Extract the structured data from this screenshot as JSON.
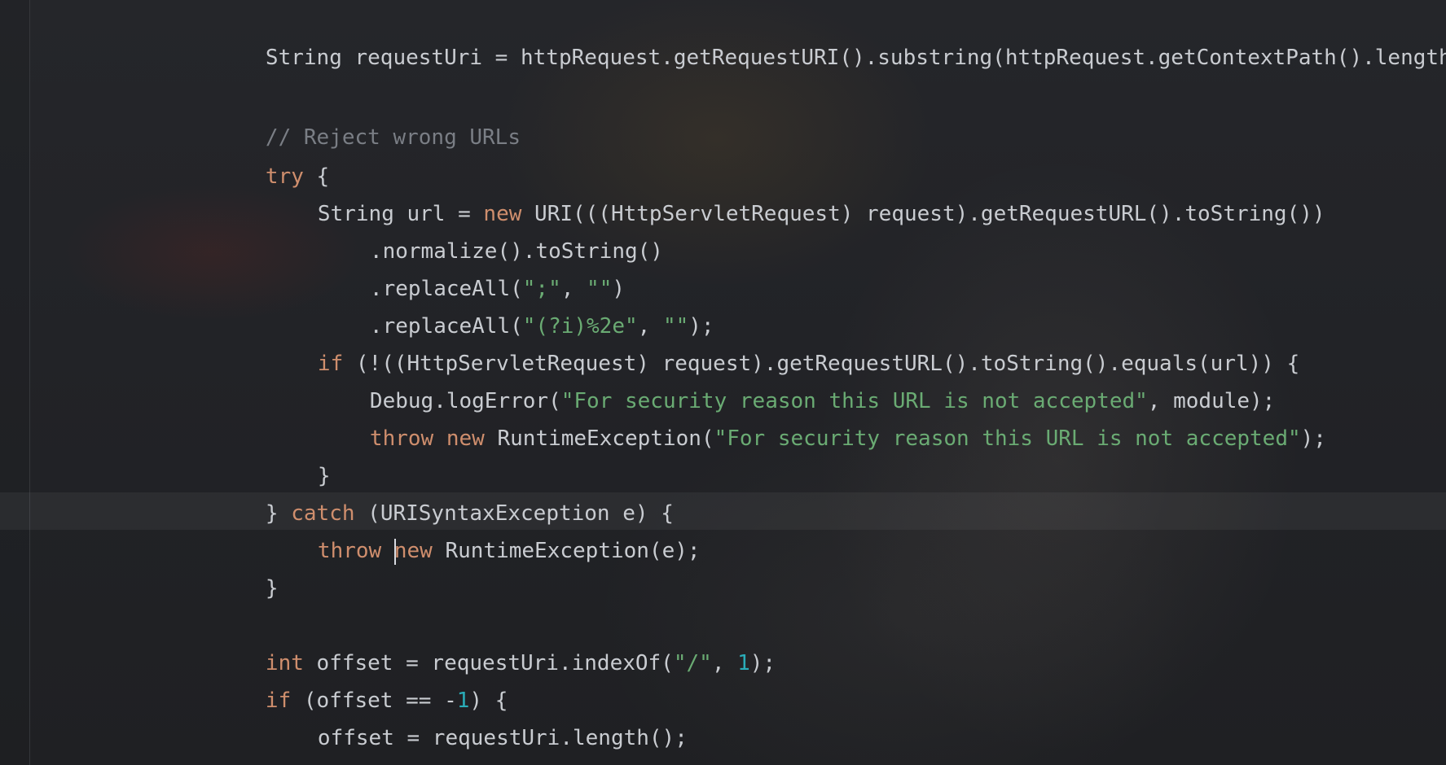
{
  "code_lines": [
    [
      {
        "t": "String requestUri = httpRequest.getRequestURI().substring(httpRequest.getContextPath().length());",
        "c": "plain"
      }
    ],
    [],
    [
      {
        "t": "// Reject wrong URLs",
        "c": "cmt"
      }
    ],
    [
      {
        "t": "try",
        "c": "kw"
      },
      {
        "t": " {",
        "c": "plain"
      }
    ],
    [
      {
        "t": "String url = ",
        "c": "plain"
      },
      {
        "t": "new",
        "c": "kw"
      },
      {
        "t": " URI(((HttpServletRequest) request).getRequestURL().toString())",
        "c": "plain"
      }
    ],
    [
      {
        "t": ".normalize().toString()",
        "c": "plain"
      }
    ],
    [
      {
        "t": ".replaceAll(",
        "c": "plain"
      },
      {
        "t": "\";\"",
        "c": "str"
      },
      {
        "t": ", ",
        "c": "plain"
      },
      {
        "t": "\"\"",
        "c": "str"
      },
      {
        "t": ")",
        "c": "plain"
      }
    ],
    [
      {
        "t": ".replaceAll(",
        "c": "plain"
      },
      {
        "t": "\"(?i)%2e\"",
        "c": "str"
      },
      {
        "t": ", ",
        "c": "plain"
      },
      {
        "t": "\"\"",
        "c": "str"
      },
      {
        "t": ");",
        "c": "plain"
      }
    ],
    [
      {
        "t": "if",
        "c": "kw"
      },
      {
        "t": " (!((HttpServletRequest) request).getRequestURL().toString().equals(url)) {",
        "c": "plain"
      }
    ],
    [
      {
        "t": "Debug.logError(",
        "c": "plain"
      },
      {
        "t": "\"For security reason this URL is not accepted\"",
        "c": "str"
      },
      {
        "t": ", module);",
        "c": "plain"
      }
    ],
    [
      {
        "t": "throw",
        "c": "kw"
      },
      {
        "t": " ",
        "c": "plain"
      },
      {
        "t": "new",
        "c": "kw"
      },
      {
        "t": " RuntimeException(",
        "c": "plain"
      },
      {
        "t": "\"For security reason this URL is not accepted\"",
        "c": "str"
      },
      {
        "t": ");",
        "c": "plain"
      }
    ],
    [
      {
        "t": "}",
        "c": "plain"
      }
    ],
    [
      {
        "t": "} ",
        "c": "plain"
      },
      {
        "t": "catch",
        "c": "kw"
      },
      {
        "t": " (URISyntaxException e) {",
        "c": "plain"
      }
    ],
    [
      {
        "t": "throw",
        "c": "kw"
      },
      {
        "t": " ",
        "c": "plain"
      },
      {
        "t": "new",
        "c": "kw"
      },
      {
        "t": " RuntimeException(e);",
        "c": "plain"
      }
    ],
    [
      {
        "t": "}",
        "c": "plain"
      }
    ],
    [],
    [
      {
        "t": "int",
        "c": "kw"
      },
      {
        "t": " offset = requestUri.indexOf(",
        "c": "plain"
      },
      {
        "t": "\"/\"",
        "c": "str"
      },
      {
        "t": ", ",
        "c": "plain"
      },
      {
        "t": "1",
        "c": "num"
      },
      {
        "t": ");",
        "c": "plain"
      }
    ],
    [
      {
        "t": "if",
        "c": "kw"
      },
      {
        "t": " (offset == -",
        "c": "plain"
      },
      {
        "t": "1",
        "c": "num"
      },
      {
        "t": ") {",
        "c": "plain"
      }
    ],
    [
      {
        "t": "offset = requestUri.length();",
        "c": "plain"
      }
    ],
    [
      {
        "t": "}",
        "c": "plain"
      }
    ]
  ],
  "syntax_colors": {
    "plain": "#c9ccd1",
    "keyword": "#cf8e6d",
    "string": "#6aab73",
    "number": "#2aacb8",
    "comment": "#7a7e85",
    "background": "#1e1f22"
  }
}
